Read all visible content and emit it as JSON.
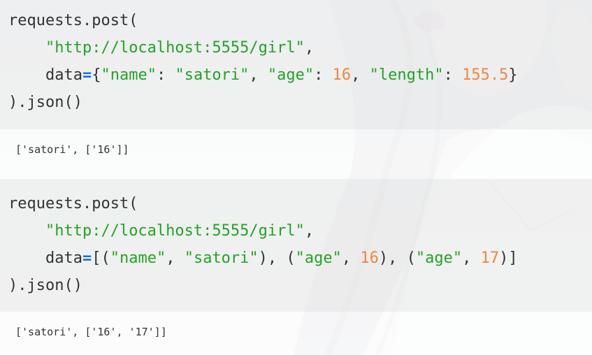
{
  "colors": {
    "string": "#22a324",
    "number": "#f0863d",
    "operator": "#1f6fd6",
    "plain": "#333333",
    "code_bg": "#f0f0f0",
    "output_bg": "#ffffff"
  },
  "background": {
    "icon": "anime-girl-illustration"
  },
  "blocks": [
    {
      "type": "code",
      "lines": [
        [
          {
            "t": "requests.post(",
            "k": "plain"
          }
        ],
        [
          {
            "t": "    ",
            "k": "plain"
          },
          {
            "t": "\"http://localhost:5555/girl\"",
            "k": "str"
          },
          {
            "t": ",",
            "k": "plain"
          }
        ],
        [
          {
            "t": "    data",
            "k": "plain"
          },
          {
            "t": "=",
            "k": "op"
          },
          {
            "t": "{",
            "k": "plain"
          },
          {
            "t": "\"name\"",
            "k": "str"
          },
          {
            "t": ": ",
            "k": "plain"
          },
          {
            "t": "\"satori\"",
            "k": "str"
          },
          {
            "t": ", ",
            "k": "plain"
          },
          {
            "t": "\"age\"",
            "k": "str"
          },
          {
            "t": ": ",
            "k": "plain"
          },
          {
            "t": "16",
            "k": "num"
          },
          {
            "t": ", ",
            "k": "plain"
          },
          {
            "t": "\"length\"",
            "k": "str"
          },
          {
            "t": ": ",
            "k": "plain"
          },
          {
            "t": "155.5",
            "k": "num"
          },
          {
            "t": "}",
            "k": "plain"
          }
        ],
        [
          {
            "t": ").json()",
            "k": "plain"
          }
        ]
      ]
    },
    {
      "type": "output",
      "text": "['satori', ['16']]"
    },
    {
      "type": "code",
      "lines": [
        [
          {
            "t": "requests.post(",
            "k": "plain"
          }
        ],
        [
          {
            "t": "    ",
            "k": "plain"
          },
          {
            "t": "\"http://localhost:5555/girl\"",
            "k": "str"
          },
          {
            "t": ",",
            "k": "plain"
          }
        ],
        [
          {
            "t": "    data",
            "k": "plain"
          },
          {
            "t": "=",
            "k": "op"
          },
          {
            "t": "[(",
            "k": "plain"
          },
          {
            "t": "\"name\"",
            "k": "str"
          },
          {
            "t": ", ",
            "k": "plain"
          },
          {
            "t": "\"satori\"",
            "k": "str"
          },
          {
            "t": "), (",
            "k": "plain"
          },
          {
            "t": "\"age\"",
            "k": "str"
          },
          {
            "t": ", ",
            "k": "plain"
          },
          {
            "t": "16",
            "k": "num"
          },
          {
            "t": "), (",
            "k": "plain"
          },
          {
            "t": "\"age\"",
            "k": "str"
          },
          {
            "t": ", ",
            "k": "plain"
          },
          {
            "t": "17",
            "k": "num"
          },
          {
            "t": ")]",
            "k": "plain"
          }
        ],
        [
          {
            "t": ").json()",
            "k": "plain"
          }
        ]
      ]
    },
    {
      "type": "output",
      "text": "['satori', ['16', '17']]"
    }
  ]
}
